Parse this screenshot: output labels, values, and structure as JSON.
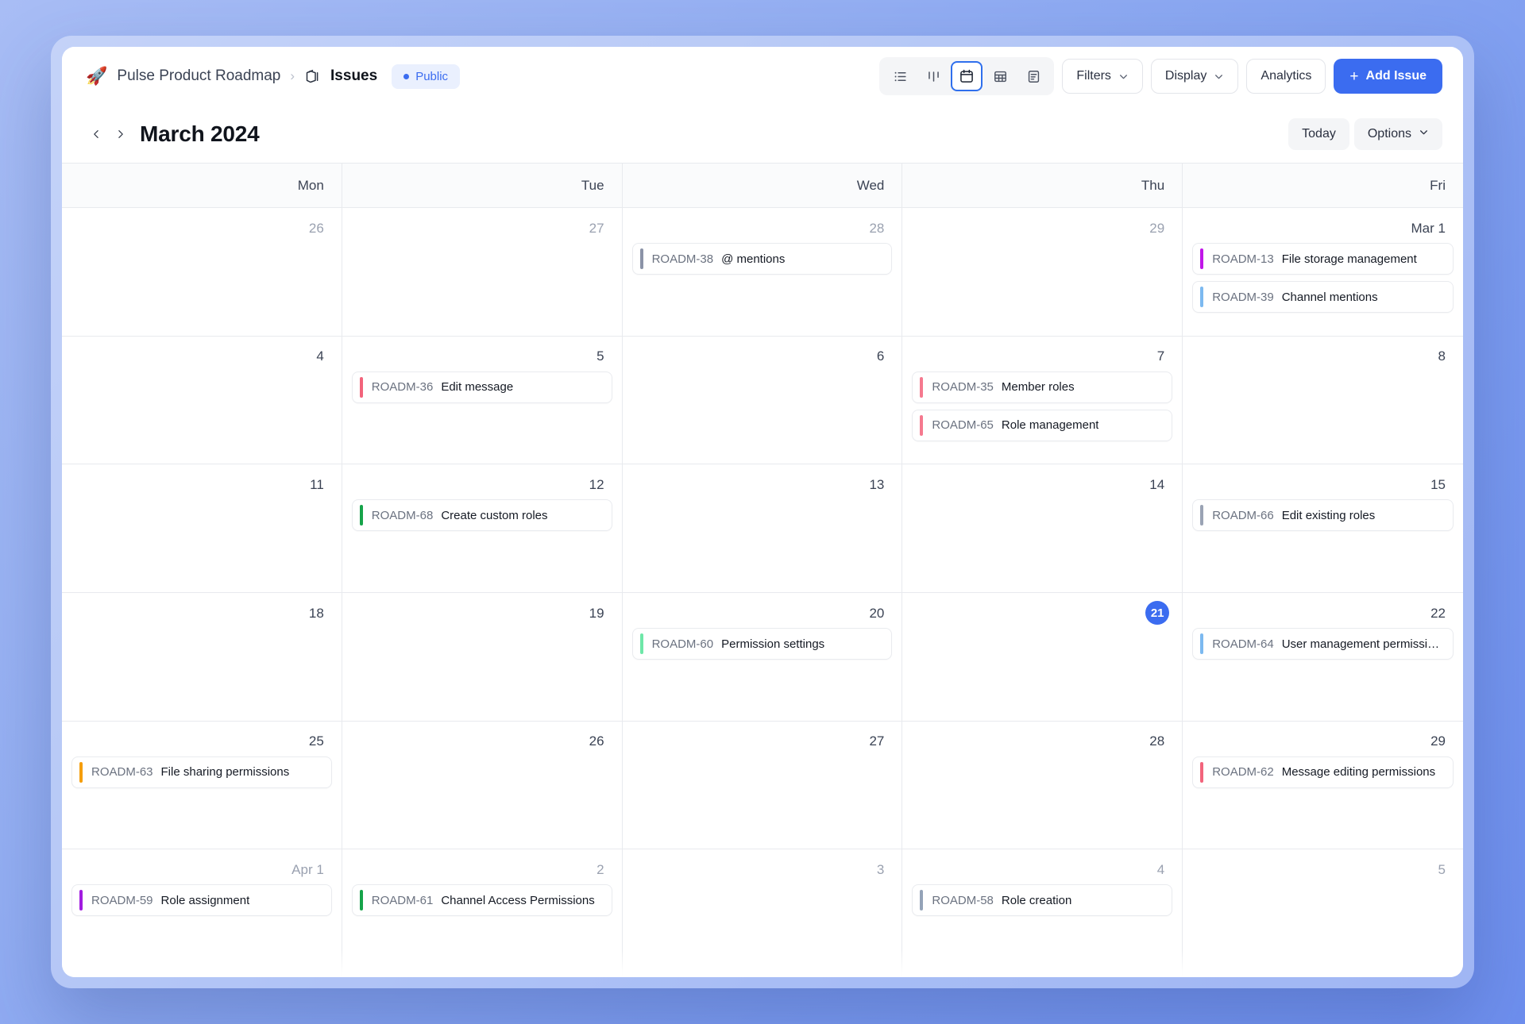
{
  "header": {
    "project_name": "Pulse Product Roadmap",
    "rocket_icon": "rocket-icon",
    "breadcrumb_separator": "›",
    "section": "Issues",
    "visibility": "Public",
    "views": [
      {
        "id": "list",
        "icon": "list-view-icon",
        "active": false
      },
      {
        "id": "board",
        "icon": "board-view-icon",
        "active": false
      },
      {
        "id": "calendar",
        "icon": "calendar-view-icon",
        "active": true
      },
      {
        "id": "table",
        "icon": "table-view-icon",
        "active": false
      },
      {
        "id": "doc",
        "icon": "doc-view-icon",
        "active": false
      }
    ],
    "filters_label": "Filters",
    "display_label": "Display",
    "analytics_label": "Analytics",
    "add_issue_label": "Add Issue",
    "add_issue_plus": "+",
    "accent_color": "#3b6cf0"
  },
  "monthbar": {
    "prev_label": "‹",
    "next_label": "›",
    "title": "March 2024",
    "today_label": "Today",
    "options_label": "Options"
  },
  "calendar": {
    "day_names": [
      "Mon",
      "Tue",
      "Wed",
      "Thu",
      "Fri"
    ],
    "today_date": "21",
    "weeks": [
      {
        "days": [
          {
            "num": "26",
            "muted": true,
            "today": false,
            "events": []
          },
          {
            "num": "27",
            "muted": true,
            "today": false,
            "events": []
          },
          {
            "num": "28",
            "muted": true,
            "today": false,
            "events": [
              {
                "key": "ROADM-38",
                "title": "@ mentions",
                "color": "#8b93a7"
              }
            ]
          },
          {
            "num": "29",
            "muted": true,
            "today": false,
            "events": []
          },
          {
            "num": "Mar 1",
            "muted": false,
            "today": false,
            "events": [
              {
                "key": "ROADM-13",
                "title": "File storage management",
                "color": "#c016e8"
              },
              {
                "key": "ROADM-39",
                "title": "Channel mentions",
                "color": "#7cb9f0"
              }
            ]
          }
        ]
      },
      {
        "days": [
          {
            "num": "4",
            "muted": false,
            "today": false,
            "events": []
          },
          {
            "num": "5",
            "muted": false,
            "today": false,
            "events": [
              {
                "key": "ROADM-36",
                "title": "Edit message",
                "color": "#f2647c"
              }
            ]
          },
          {
            "num": "6",
            "muted": false,
            "today": false,
            "events": []
          },
          {
            "num": "7",
            "muted": false,
            "today": false,
            "events": [
              {
                "key": "ROADM-35",
                "title": "Member roles",
                "color": "#f5798f"
              },
              {
                "key": "ROADM-65",
                "title": "Role management",
                "color": "#f5798f"
              }
            ]
          },
          {
            "num": "8",
            "muted": false,
            "today": false,
            "events": []
          }
        ]
      },
      {
        "days": [
          {
            "num": "11",
            "muted": false,
            "today": false,
            "events": []
          },
          {
            "num": "12",
            "muted": false,
            "today": false,
            "events": [
              {
                "key": "ROADM-68",
                "title": "Create custom roles",
                "color": "#16a34a"
              }
            ]
          },
          {
            "num": "13",
            "muted": false,
            "today": false,
            "events": []
          },
          {
            "num": "14",
            "muted": false,
            "today": false,
            "events": []
          },
          {
            "num": "15",
            "muted": false,
            "today": false,
            "events": [
              {
                "key": "ROADM-66",
                "title": "Edit existing roles",
                "color": "#9aa3b4"
              }
            ]
          }
        ]
      },
      {
        "days": [
          {
            "num": "18",
            "muted": false,
            "today": false,
            "events": []
          },
          {
            "num": "19",
            "muted": false,
            "today": false,
            "events": []
          },
          {
            "num": "20",
            "muted": false,
            "today": false,
            "events": [
              {
                "key": "ROADM-60",
                "title": "Permission settings",
                "color": "#6ee7a8"
              }
            ]
          },
          {
            "num": "21",
            "muted": false,
            "today": true,
            "events": []
          },
          {
            "num": "22",
            "muted": false,
            "today": false,
            "events": [
              {
                "key": "ROADM-64",
                "title": "User management permissi…",
                "color": "#7cb9f0"
              }
            ]
          }
        ]
      },
      {
        "days": [
          {
            "num": "25",
            "muted": false,
            "today": false,
            "events": [
              {
                "key": "ROADM-63",
                "title": "File sharing permissions",
                "color": "#f59e0b"
              }
            ]
          },
          {
            "num": "26",
            "muted": false,
            "today": false,
            "events": []
          },
          {
            "num": "27",
            "muted": false,
            "today": false,
            "events": []
          },
          {
            "num": "28",
            "muted": false,
            "today": false,
            "events": []
          },
          {
            "num": "29",
            "muted": false,
            "today": false,
            "events": [
              {
                "key": "ROADM-62",
                "title": "Message editing permissions",
                "color": "#f2647c"
              }
            ]
          }
        ]
      },
      {
        "days": [
          {
            "num": "Apr 1",
            "muted": true,
            "today": false,
            "events": [
              {
                "key": "ROADM-59",
                "title": "Role assignment",
                "color": "#a21ce0"
              }
            ]
          },
          {
            "num": "2",
            "muted": true,
            "today": false,
            "events": [
              {
                "key": "ROADM-61",
                "title": "Channel Access Permissions",
                "color": "#16a34a"
              }
            ]
          },
          {
            "num": "3",
            "muted": true,
            "today": false,
            "events": []
          },
          {
            "num": "4",
            "muted": true,
            "today": false,
            "events": [
              {
                "key": "ROADM-58",
                "title": "Role creation",
                "color": "#94a3b8"
              }
            ]
          },
          {
            "num": "5",
            "muted": true,
            "today": false,
            "events": []
          }
        ]
      }
    ]
  }
}
